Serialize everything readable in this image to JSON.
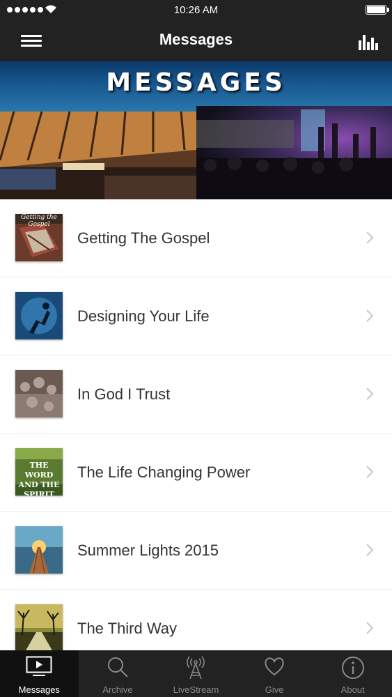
{
  "status_bar": {
    "time": "10:26 AM"
  },
  "nav": {
    "title": "Messages"
  },
  "banner": {
    "title": "MESSAGES"
  },
  "messages": [
    {
      "title": "Getting The Gospel",
      "thumb_text": "Getting the Gospel"
    },
    {
      "title": "Designing Your Life",
      "thumb_text": ""
    },
    {
      "title": "In God I Trust",
      "thumb_text": ""
    },
    {
      "title": "The Life Changing Power",
      "thumb_text": "THE WORD AND THE SPIRIT"
    },
    {
      "title": "Summer Lights 2015",
      "thumb_text": ""
    },
    {
      "title": "The Third Way",
      "thumb_text": ""
    }
  ],
  "tabs": [
    {
      "label": "Messages",
      "icon": "tv-icon",
      "active": true
    },
    {
      "label": "Archive",
      "icon": "search-icon",
      "active": false
    },
    {
      "label": "LiveStream",
      "icon": "broadcast-tower-icon",
      "active": false
    },
    {
      "label": "Give",
      "icon": "heart-icon",
      "active": false
    },
    {
      "label": "About",
      "icon": "info-icon",
      "active": false
    }
  ],
  "colors": {
    "bar": "#222222",
    "label": "#333333",
    "tab_inactive": "#8a8a8a"
  }
}
